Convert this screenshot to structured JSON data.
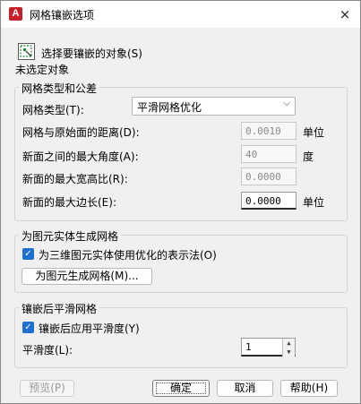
{
  "window": {
    "title": "网格镶嵌选项",
    "app_icon": "A"
  },
  "select_objects": {
    "button_label": "选择要镶嵌的对象(S)",
    "status": "未选定对象"
  },
  "mesh_type_group": {
    "title": "网格类型和公差",
    "mesh_type_label": "网格类型(T):",
    "mesh_type_value": "平滑网格优化",
    "distance_label": "网格与原始面的距离(D):",
    "distance_value": "0.0010",
    "distance_unit": "单位",
    "angle_label": "新面之间的最大角度(A):",
    "angle_value": "40",
    "angle_unit": "度",
    "aspect_label": "新面的最大宽高比(R):",
    "aspect_value": "0.0000",
    "edge_label": "新面的最大边长(E):",
    "edge_value": "0.0000",
    "edge_unit": "单位"
  },
  "solid_group": {
    "title": "为图元实体生成网格",
    "optimized_checkbox": "为三维图元实体使用优化的表示法(O)",
    "optimized_checked": true,
    "generate_button": "为图元生成网格(M)..."
  },
  "smooth_group": {
    "title": "镶嵌后平滑网格",
    "apply_checkbox": "镶嵌后应用平滑度(Y)",
    "apply_checked": true,
    "level_label": "平滑度(L):",
    "level_value": "1"
  },
  "footer": {
    "preview": "预览(P)",
    "ok": "确定",
    "cancel": "取消",
    "help": "帮助(H)"
  },
  "icons": {
    "close": "×",
    "check": "✓",
    "chevron": "⌵",
    "spin_up": "▲",
    "spin_down": "▼"
  }
}
